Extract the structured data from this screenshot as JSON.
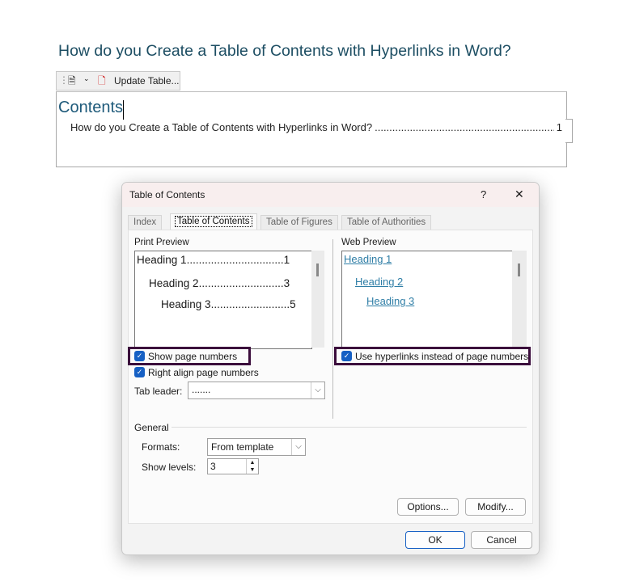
{
  "document": {
    "title": "How do you Create a Table of Contents with Hyperlinks in Word?",
    "toolbar": {
      "update_label": "Update Table..."
    },
    "toc_heading": "Contents",
    "entries": [
      {
        "text": "How do you Create a Table of Contents with Hyperlinks in Word?",
        "dots": "..............................................................................................................................",
        "page": "1"
      }
    ]
  },
  "dialog": {
    "title": "Table of Contents",
    "help": "?",
    "close": "✕",
    "tabs": [
      {
        "label": "Index"
      },
      {
        "label": "Table of Contents",
        "active": true
      },
      {
        "label": "Table of Figures"
      },
      {
        "label": "Table of Authorities"
      }
    ],
    "print_preview": {
      "label": "Print Preview",
      "lines": [
        {
          "text": "Heading 1",
          "dots": "................................",
          "page": "1"
        },
        {
          "text": "Heading 2",
          "dots": "............................",
          "page": "3"
        },
        {
          "text": "Heading 3",
          "dots": "..........................",
          "page": "5"
        }
      ]
    },
    "web_preview": {
      "label": "Web Preview",
      "links": [
        "Heading 1",
        "Heading 2",
        "Heading 3"
      ],
      "link_color": "#2f7ea6"
    },
    "show_page_numbers": {
      "label": "Show page numbers",
      "checked": true
    },
    "right_align": {
      "label": "Right align page numbers",
      "checked": true
    },
    "use_hyperlinks": {
      "label": "Use hyperlinks instead of page numbers",
      "checked": true
    },
    "tab_leader": {
      "label": "Tab leader:",
      "value": "......."
    },
    "general": {
      "label": "General",
      "formats_label": "Formats:",
      "formats_value": "From template",
      "levels_label": "Show levels:",
      "levels_value": "3"
    },
    "buttons": {
      "options": "Options...",
      "modify": "Modify...",
      "ok": "OK",
      "cancel": "Cancel"
    },
    "highlight_color": "#3b0d3c",
    "accent": "#1660c4"
  }
}
